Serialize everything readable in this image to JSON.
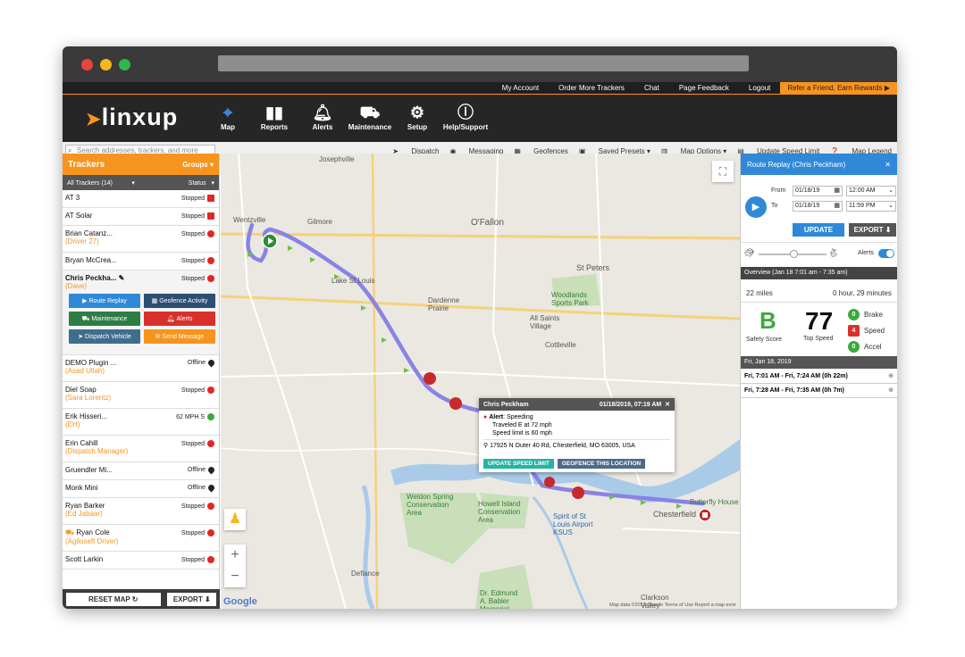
{
  "topnav": {
    "my_account": "My Account",
    "order": "Order More Trackers",
    "chat": "Chat",
    "feedback": "Page Feedback",
    "logout": "Logout",
    "refer": "Refer a Friend, Earn Rewards ▶"
  },
  "logo": "linxup",
  "nav": {
    "map": "Map",
    "reports": "Reports",
    "alerts": "Alerts",
    "maintenance": "Maintenance",
    "setup": "Setup",
    "help": "Help/Support"
  },
  "search": {
    "placeholder": "Search addresses, trackers, and more"
  },
  "tools": {
    "dispatch": "Dispatch",
    "messaging": "Messaging",
    "geofences": "Geofences",
    "presets": "Saved Presets",
    "options": "Map Options",
    "speed": "Update Speed Limit",
    "legend": "Map Legend"
  },
  "sidebar": {
    "title": "Trackers",
    "groups": "Groups",
    "all": "All Trackers (14)",
    "status": "Status",
    "rows": [
      {
        "name": "AT 3",
        "driver": "",
        "status": "Stopped"
      },
      {
        "name": "AT Solar",
        "driver": "",
        "status": "Stopped"
      },
      {
        "name": "Brian Catanz...",
        "driver": "(Driver 27)",
        "status": "Stopped"
      },
      {
        "name": "Bryan McCrea...",
        "driver": "",
        "status": "Stopped"
      },
      {
        "name": "Chris Peckha...",
        "driver": "(Dave)",
        "status": "Stopped"
      },
      {
        "name": "DEMO Plugin ...",
        "driver": "(Asad Ullah)",
        "status": "Offline"
      },
      {
        "name": "Diel Soap",
        "driver": "(Sara Lorentz)",
        "status": "Stopped"
      },
      {
        "name": "Erik Hisseri...",
        "driver": "(EH)",
        "status": "62 MPH S"
      },
      {
        "name": "Erin Cahill",
        "driver": "(Dispatch Manager)",
        "status": "Stopped"
      },
      {
        "name": "Gruendler Mi...",
        "driver": "",
        "status": "Offline"
      },
      {
        "name": "Monk Mini",
        "driver": "",
        "status": "Offline"
      },
      {
        "name": "Ryan Barker",
        "driver": "(Ed Jabaar)",
        "status": "Stopped"
      },
      {
        "name": "Ryan Cole",
        "driver": "(Agiloseft Driver)",
        "status": "Stopped"
      },
      {
        "name": "Scott Larkin",
        "driver": "",
        "status": "Stopped"
      }
    ],
    "actions": {
      "route_replay": "Route Replay",
      "geofence_activity": "Geofence Activity",
      "maintenance": "Maintenance",
      "alerts": "Alerts",
      "dispatch_vehicle": "Dispatch Vehicle",
      "send_message": "Send Message"
    },
    "reset": "RESET MAP ↻",
    "export": "EXPORT ⬇"
  },
  "map": {
    "labels": {
      "josephville": "Josephville",
      "wentzville": "Wentzville",
      "gilmore": "Gilmore",
      "ofallon": "O'Fallon",
      "lake_st_louis": "Lake St Louis",
      "st_peters": "St Peters",
      "woodlands": "Woodlands Sports Park",
      "dardenne": "Dardenne Prairie",
      "all_saints": "All Saints Village",
      "cottleville": "Cottleville",
      "weldon": "Weldon Spring Conservation Area",
      "howell": "Howell Island Conservation Area",
      "spirit": "Spirit of St Louis Airport KSUS",
      "chesterfield": "Chesterfield",
      "butterfly": "Butterfly House",
      "defiance": "Defiance",
      "clarkson": "Clarkson Valley",
      "dr_edmund": "Dr. Edmund A. Babler Memorial",
      "google": "Google"
    },
    "footer": "Map data ©2019 Google  Terms of Use  Report a map error",
    "popup": {
      "name": "Chris Peckham",
      "time": "01/18/2019, 07:19 AM",
      "alert_label": "Alert",
      "alert_type": ": Speeding",
      "line1": "Traveled E at 72 mph",
      "line2": "Speed limit is 60 mph",
      "address": "17925 N Outer 40 Rd, Chesterfield, MO 63005, USA",
      "btn_speed": "UPDATE SPEED LIMIT",
      "btn_geofence": "GEOFENCE THIS LOCATION"
    }
  },
  "replay": {
    "title": "Route Replay (Chris Peckham)",
    "from_label": "From",
    "to_label": "To",
    "from_date": "01/18/19",
    "from_time": "12:00 AM",
    "to_date": "01/18/19",
    "to_time": "11:59 PM",
    "update": "UPDATE",
    "export": "EXPORT ⬇",
    "alerts_label": "Alerts",
    "overview": "Overview (Jan 18 7:01 am - 7:35 am)",
    "miles": "22 miles",
    "duration": "0 hour, 29 minutes",
    "grade": "B",
    "grade_label": "Safety Score",
    "top_speed": "77",
    "top_speed_label": "Top Speed",
    "brake_count": "0",
    "brake_label": "Brake",
    "speed_count": "4",
    "speed_label": "Speed",
    "accel_count": "0",
    "accel_label": "Accel",
    "day": "Fri, Jan 18, 2019",
    "trips": [
      "Fri, 7:01 AM - Fri, 7:24 AM (0h 22m)",
      "Fri, 7:28 AM - Fri, 7:35 AM (0h 7m)"
    ]
  }
}
